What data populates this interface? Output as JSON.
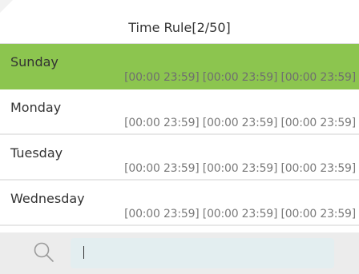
{
  "header": {
    "title": "Time Rule[2/50]"
  },
  "rules": [
    {
      "day": "Sunday",
      "ranges": "[00:00 23:59] [00:00 23:59] [00:00 23:59]",
      "selected": true
    },
    {
      "day": "Monday",
      "ranges": "[00:00 23:59] [00:00 23:59] [00:00 23:59]",
      "selected": false
    },
    {
      "day": "Tuesday",
      "ranges": "[00:00 23:59] [00:00 23:59] [00:00 23:59]",
      "selected": false
    },
    {
      "day": "Wednesday",
      "ranges": "[00:00 23:59] [00:00 23:59] [00:00 23:59]",
      "selected": false
    }
  ],
  "search": {
    "icon": "search-icon",
    "value": ""
  },
  "colors": {
    "selected": "#8cc54f",
    "search_bg": "#ececec",
    "input_bg": "#e3eef0"
  }
}
